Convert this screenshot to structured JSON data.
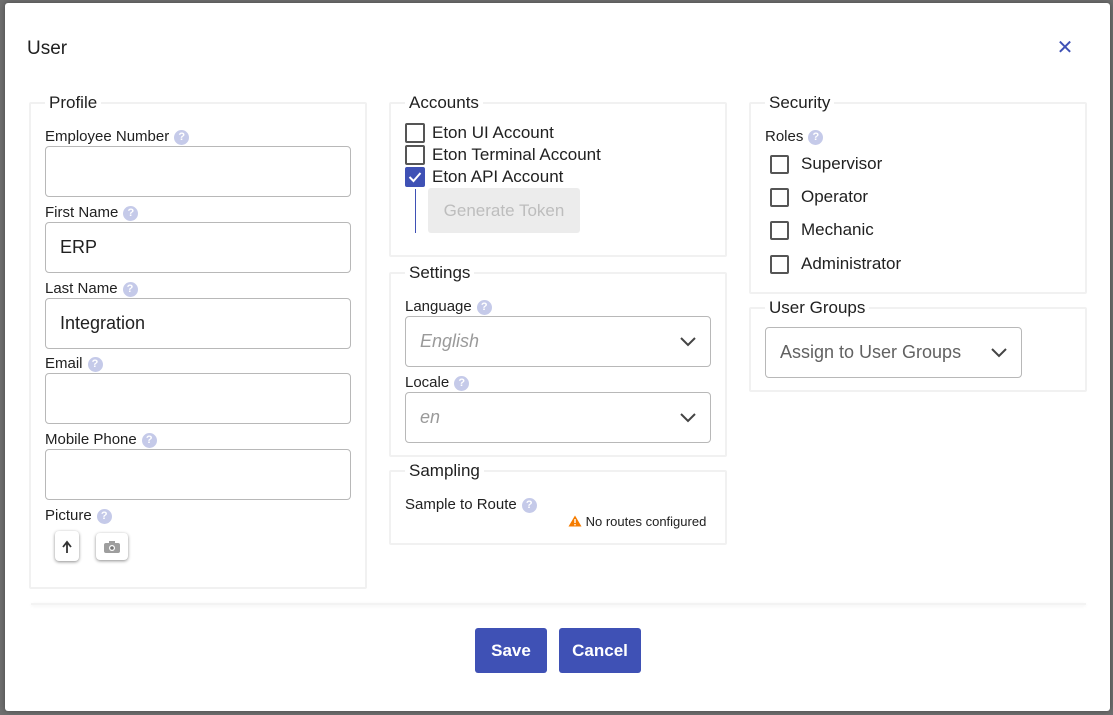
{
  "dialog": {
    "title": "User"
  },
  "profile": {
    "legend": "Profile",
    "employee_number": {
      "label": "Employee Number",
      "value": ""
    },
    "first_name": {
      "label": "First Name",
      "value": "ERP"
    },
    "last_name": {
      "label": "Last Name",
      "value": "Integration"
    },
    "email": {
      "label": "Email",
      "value": ""
    },
    "mobile_phone": {
      "label": "Mobile Phone",
      "value": ""
    },
    "picture": {
      "label": "Picture",
      "icons": [
        "upload-file-icon",
        "camera-icon"
      ]
    }
  },
  "accounts": {
    "legend": "Accounts",
    "items": [
      {
        "label": "Eton UI Account",
        "checked": false
      },
      {
        "label": "Eton Terminal Account",
        "checked": false
      },
      {
        "label": "Eton API Account",
        "checked": true
      }
    ],
    "generate_token_label": "Generate Token"
  },
  "settings": {
    "legend": "Settings",
    "language": {
      "label": "Language",
      "value": "English"
    },
    "locale": {
      "label": "Locale",
      "value": "en"
    }
  },
  "sampling": {
    "legend": "Sampling",
    "sample_to_route_label": "Sample to Route",
    "warning_text": "No routes configured"
  },
  "security": {
    "legend": "Security",
    "roles_label": "Roles",
    "roles": [
      {
        "label": "Supervisor",
        "checked": false
      },
      {
        "label": "Operator",
        "checked": false
      },
      {
        "label": "Mechanic",
        "checked": false
      },
      {
        "label": "Administrator",
        "checked": false
      }
    ]
  },
  "user_groups": {
    "legend": "User Groups",
    "placeholder": "Assign to User Groups"
  },
  "footer": {
    "save_label": "Save",
    "cancel_label": "Cancel"
  },
  "help_glyph": "?",
  "colors": {
    "accent": "#3f51b5",
    "help": "#c5cae9",
    "warning": "#f57c00",
    "backdrop": "#6f6f6f"
  }
}
